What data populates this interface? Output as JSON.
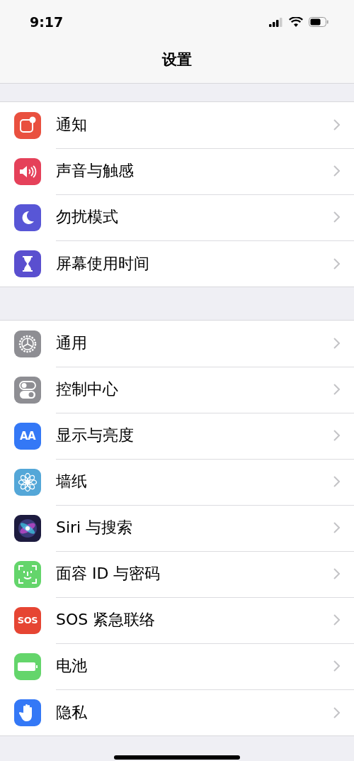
{
  "status_bar": {
    "time": "9:17"
  },
  "nav": {
    "title": "设置"
  },
  "groups": [
    {
      "items": [
        {
          "label": "通知",
          "kind": "notifications",
          "color": "#e9503f"
        },
        {
          "label": "声音与触感",
          "kind": "sound",
          "color": "#e5415a"
        },
        {
          "label": "勿扰模式",
          "kind": "moon",
          "color": "#5856d6"
        },
        {
          "label": "屏幕使用时间",
          "kind": "hourglass",
          "color": "#5a4fcf"
        }
      ]
    },
    {
      "items": [
        {
          "label": "通用",
          "kind": "gear",
          "color": "#8e8e93"
        },
        {
          "label": "控制中心",
          "kind": "toggles",
          "color": "#8e8e93"
        },
        {
          "label": "显示与亮度",
          "kind": "display",
          "color": "#3478f6",
          "icon_text": "AA"
        },
        {
          "label": "墙纸",
          "kind": "flower",
          "color": "#54a7d8"
        },
        {
          "label": "Siri 与搜索",
          "kind": "siri",
          "color": "#1d1b3f"
        },
        {
          "label": "面容 ID 与密码",
          "kind": "faceid",
          "color": "#64d56b"
        },
        {
          "label": "SOS 紧急联络",
          "kind": "sos",
          "color": "#e64533",
          "icon_text": "SOS"
        },
        {
          "label": "电池",
          "kind": "battery",
          "color": "#64d56b"
        },
        {
          "label": "隐私",
          "kind": "hand",
          "color": "#3478f6"
        }
      ]
    }
  ]
}
